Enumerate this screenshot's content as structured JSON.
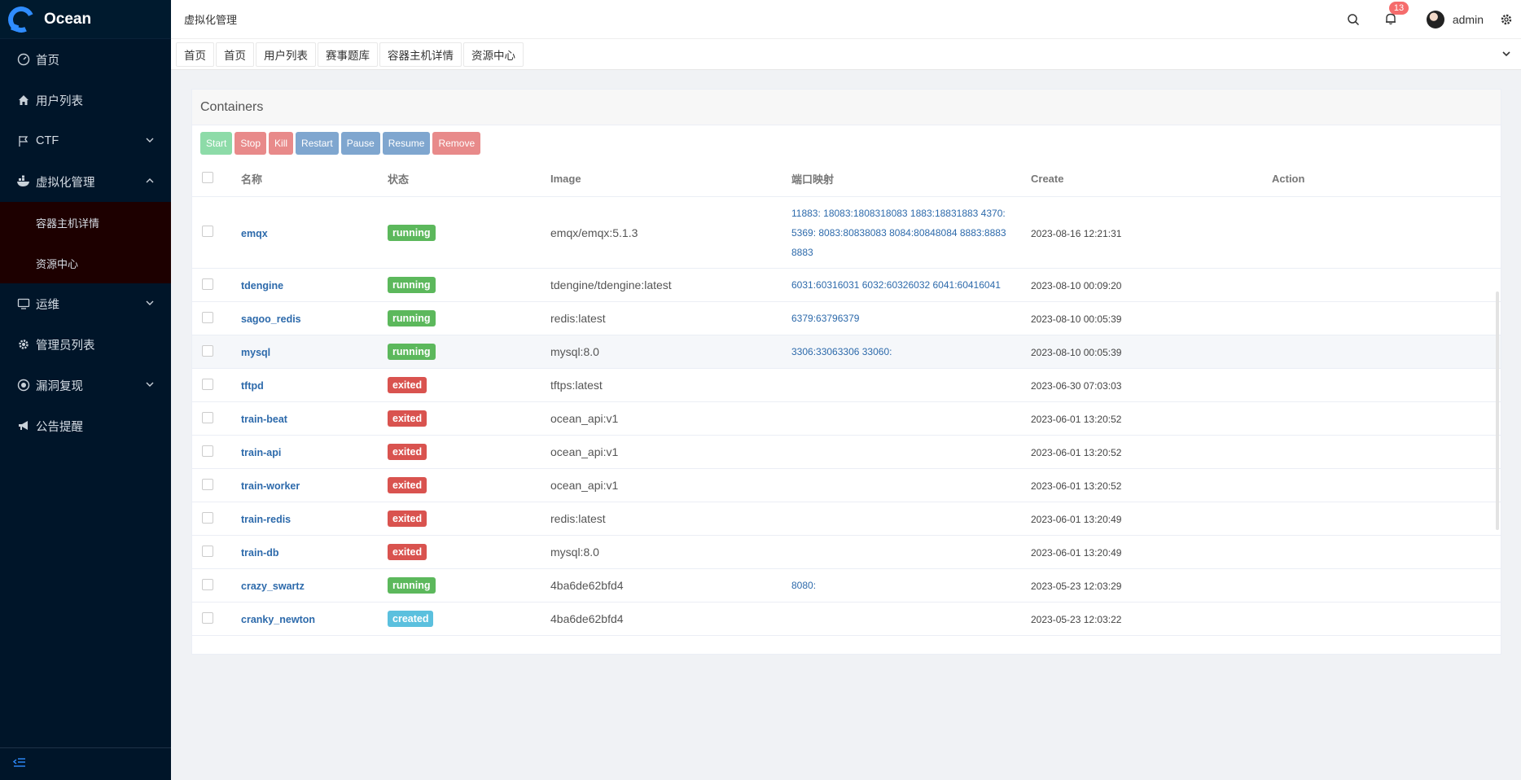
{
  "sidebar": {
    "logo_text": "Ocean",
    "items": [
      {
        "label": "首页",
        "icon": "dashboard-icon"
      },
      {
        "label": "用户列表",
        "icon": "home-icon"
      },
      {
        "label": "CTF",
        "icon": "flag-icon",
        "expandable": true
      },
      {
        "label": "虚拟化管理",
        "icon": "docker-icon",
        "expanded": true
      },
      {
        "label": "运维",
        "icon": "monitor-icon",
        "expandable": true
      },
      {
        "label": "管理员列表",
        "icon": "gear-icon"
      },
      {
        "label": "漏洞复现",
        "icon": "bug-icon",
        "expandable": true
      },
      {
        "label": "公告提醒",
        "icon": "megaphone-icon"
      }
    ],
    "submenu": [
      {
        "label": "容器主机详情"
      },
      {
        "label": "资源中心"
      }
    ]
  },
  "header": {
    "breadcrumb": "虚拟化管理",
    "notification_count": "13",
    "username": "admin"
  },
  "tabs": [
    {
      "label": "首页"
    },
    {
      "label": "首页"
    },
    {
      "label": "用户列表"
    },
    {
      "label": "赛事题库"
    },
    {
      "label": "容器主机详情"
    },
    {
      "label": "资源中心"
    }
  ],
  "card": {
    "title": "Containers",
    "buttons": [
      "Start",
      "Stop",
      "Kill",
      "Restart",
      "Pause",
      "Resume",
      "Remove"
    ]
  },
  "table": {
    "columns": [
      "名称",
      "状态",
      "Image",
      "端口映射",
      "Create",
      "Action"
    ],
    "rows": [
      {
        "name": "emqx",
        "state": "running",
        "image": "emqx/emqx:5.1.3",
        "ports": "11883: 18083:1808318083 1883:18831883 4370: 5369: 8083:80838083 8084:80848084 8883:8883 8883",
        "create": "2023-08-16 12:21:31"
      },
      {
        "name": "tdengine",
        "state": "running",
        "image": "tdengine/tdengine:latest",
        "ports": "6031:60316031 6032:60326032 6041:60416041",
        "create": "2023-08-10 00:09:20"
      },
      {
        "name": "sagoo_redis",
        "state": "running",
        "image": "redis:latest",
        "ports": "6379:63796379",
        "create": "2023-08-10 00:05:39"
      },
      {
        "name": "mysql",
        "state": "running",
        "image": "mysql:8.0",
        "ports": "3306:33063306 33060:",
        "create": "2023-08-10 00:05:39"
      },
      {
        "name": "tftpd",
        "state": "exited",
        "image": "tftps:latest",
        "ports": "",
        "create": "2023-06-30 07:03:03"
      },
      {
        "name": "train-beat",
        "state": "exited",
        "image": "ocean_api:v1",
        "ports": "",
        "create": "2023-06-01 13:20:52"
      },
      {
        "name": "train-api",
        "state": "exited",
        "image": "ocean_api:v1",
        "ports": "",
        "create": "2023-06-01 13:20:52"
      },
      {
        "name": "train-worker",
        "state": "exited",
        "image": "ocean_api:v1",
        "ports": "",
        "create": "2023-06-01 13:20:52"
      },
      {
        "name": "train-redis",
        "state": "exited",
        "image": "redis:latest",
        "ports": "",
        "create": "2023-06-01 13:20:49"
      },
      {
        "name": "train-db",
        "state": "exited",
        "image": "mysql:8.0",
        "ports": "",
        "create": "2023-06-01 13:20:49"
      },
      {
        "name": "crazy_swartz",
        "state": "running",
        "image": "4ba6de62bfd4",
        "ports": "8080:",
        "create": "2023-05-23 12:03:29"
      },
      {
        "name": "cranky_newton",
        "state": "created",
        "image": "4ba6de62bfd4",
        "ports": "",
        "create": "2023-05-23 12:03:22"
      }
    ]
  },
  "colors": {
    "sidebar_bg": "#001529",
    "submenu_bg": "#1d0000",
    "accent": "#2f8cff",
    "running": "#5cb85c",
    "exited": "#d9534f",
    "created": "#5bc0de",
    "link": "#2d6aab"
  }
}
